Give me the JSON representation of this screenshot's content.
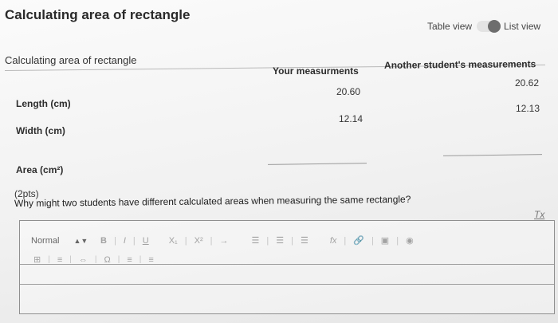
{
  "page": {
    "title": "Calculating area of rectangle"
  },
  "view_toggle": {
    "left_label": "Table view",
    "right_label": "List view"
  },
  "table": {
    "title": "Calculating area of rectangle",
    "columns": [
      "Your measurments",
      "Another student's measurements"
    ],
    "rows": [
      {
        "label": "Length (cm)",
        "yours": "20.60",
        "other": "20.62"
      },
      {
        "label": "Width (cm)",
        "yours": "12.14",
        "other": "12.13"
      },
      {
        "label": "Area (cm²)",
        "yours": "",
        "other": ""
      }
    ]
  },
  "question": {
    "points": "(2pts)",
    "text": "Why might two students have different calculated areas when measuring the same rectangle?"
  },
  "editor": {
    "clear_format_label": "Tx",
    "format_value": "Normal",
    "toolbar": {
      "bold": "B",
      "italic": "I",
      "underline": "U",
      "subscript": "X₁",
      "superscript": "X²",
      "formula": "fx"
    }
  }
}
